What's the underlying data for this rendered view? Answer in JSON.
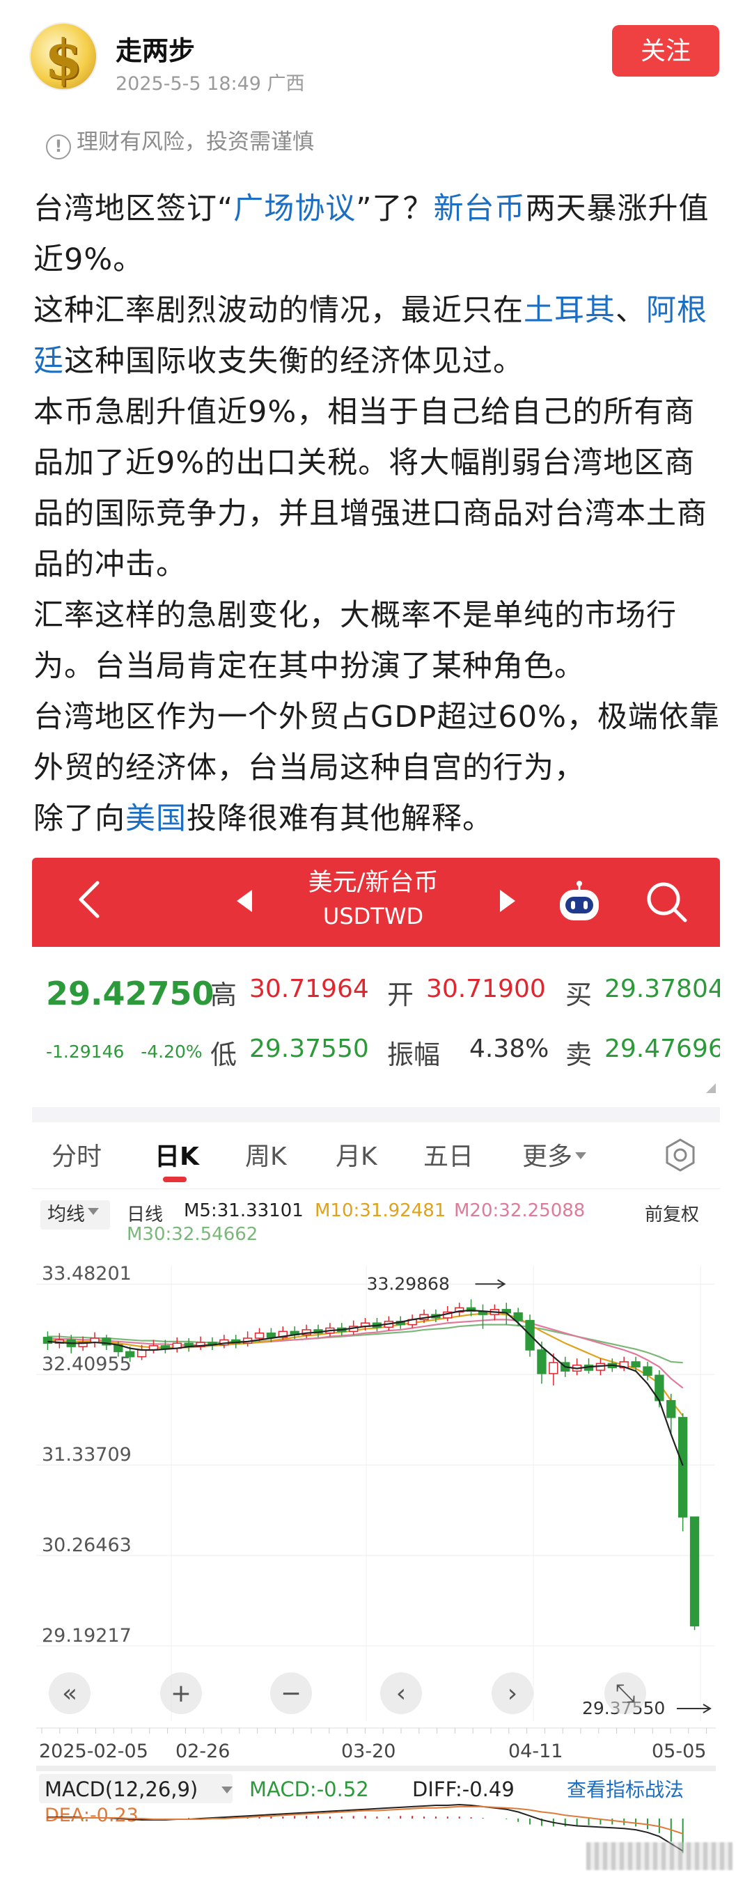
{
  "post": {
    "author": "走两步",
    "meta": "2025-5-5 18:49 广西",
    "follow_label": "关注",
    "risk_notice": "理财有风险，投资需谨慎"
  },
  "article": {
    "p1_a": "台湾地区签订“",
    "p1_link1": "广场协议",
    "p1_b": "”了？",
    "p1_link2": "新台币",
    "p1_c": "两天暴涨升值近9%。",
    "p2_a": "这种汇率剧烈波动的情况，最近只在",
    "p2_link1": "土耳其",
    "p2_b": "、",
    "p2_link2": "阿根廷",
    "p2_c": "这种国际收支失衡的经济体见过。",
    "p3": "本币急剧升值近9%，相当于自己给自己的所有商品加了近9%的出口关税。将大幅削弱台湾地区商品的国际竞争力，并且增强进口商品对台湾本土商品的冲击。",
    "p4": "汇率这样的急剧变化，大概率不是单纯的市场行为。台当局肯定在其中扮演了某种角色。",
    "p5": "台湾地区作为一个外贸占GDP超过60%，极端依靠外贸的经济体，台当局这种自宫的行为，",
    "p6_a": "除了向",
    "p6_link": "美国",
    "p6_b": "投降很难有其他解释。"
  },
  "quote": {
    "pair_name": "美元/新台币",
    "pair_code": "USDTWD",
    "price": "29.42750",
    "change": "-1.29146",
    "change_pct": "-4.20%",
    "stats": {
      "high_label": "高",
      "high": "30.71964",
      "open_label": "开",
      "open": "30.71900",
      "buy_label": "买",
      "buy": "29.37804",
      "low_label": "低",
      "low": "29.37550",
      "amp_label": "振幅",
      "amp": "4.38%",
      "sell_label": "卖",
      "sell": "29.47696"
    },
    "tabs": [
      "分时",
      "日K",
      "周K",
      "月K",
      "五日",
      "更多"
    ],
    "active_tab": "日K",
    "avg_dropdown": "均线",
    "ma": {
      "day": "日线",
      "m5": "M5:31.33101",
      "m10": "M10:31.92481",
      "m20": "M20:32.25088",
      "m30": "M30:32.54662",
      "adjust": "前复权"
    },
    "colors": {
      "up": "#e0262e",
      "down": "#2c9a3a",
      "m5": "#222222",
      "m10": "#e0a21b",
      "m20": "#e07a9a",
      "m30": "#7ab87a"
    },
    "macd": {
      "label": "MACD(12,26,9)",
      "macd": "MACD:-0.52",
      "diff": "DIFF:-0.49",
      "dea": "DEA:-0.23",
      "link": "查看指标战法"
    }
  },
  "chart_data": {
    "type": "candlestick",
    "y_ticks": [
      "33.48201",
      "32.40955",
      "31.33709",
      "30.26463",
      "29.19217"
    ],
    "y_tick_values": [
      33.48201,
      32.40955,
      31.33709,
      30.26463,
      29.19217
    ],
    "ylim": [
      29.19217,
      33.48201
    ],
    "x_ticks": [
      "2025-02-05",
      "02-26",
      "03-20",
      "04-11",
      "05-05"
    ],
    "max_label": "33.29868",
    "min_label": "29.37550",
    "candles": [
      {
        "o": 32.85,
        "c": 32.78,
        "h": 32.92,
        "l": 32.7
      },
      {
        "o": 32.78,
        "c": 32.82,
        "h": 32.9,
        "l": 32.72
      },
      {
        "o": 32.82,
        "c": 32.74,
        "h": 32.88,
        "l": 32.66
      },
      {
        "o": 32.74,
        "c": 32.79,
        "h": 32.86,
        "l": 32.69
      },
      {
        "o": 32.79,
        "c": 32.84,
        "h": 32.91,
        "l": 32.73
      },
      {
        "o": 32.84,
        "c": 32.76,
        "h": 32.88,
        "l": 32.7
      },
      {
        "o": 32.76,
        "c": 32.68,
        "h": 32.8,
        "l": 32.62
      },
      {
        "o": 32.68,
        "c": 32.62,
        "h": 32.74,
        "l": 32.56
      },
      {
        "o": 32.62,
        "c": 32.7,
        "h": 32.76,
        "l": 32.58
      },
      {
        "o": 32.7,
        "c": 32.75,
        "h": 32.82,
        "l": 32.66
      },
      {
        "o": 32.75,
        "c": 32.72,
        "h": 32.82,
        "l": 32.66
      },
      {
        "o": 32.72,
        "c": 32.78,
        "h": 32.85,
        "l": 32.67
      },
      {
        "o": 32.78,
        "c": 32.74,
        "h": 32.84,
        "l": 32.68
      },
      {
        "o": 32.74,
        "c": 32.79,
        "h": 32.86,
        "l": 32.7
      },
      {
        "o": 32.79,
        "c": 32.76,
        "h": 32.85,
        "l": 32.7
      },
      {
        "o": 32.76,
        "c": 32.82,
        "h": 32.88,
        "l": 32.72
      },
      {
        "o": 32.82,
        "c": 32.78,
        "h": 32.88,
        "l": 32.72
      },
      {
        "o": 32.78,
        "c": 32.84,
        "h": 32.92,
        "l": 32.74
      },
      {
        "o": 32.84,
        "c": 32.9,
        "h": 32.96,
        "l": 32.8
      },
      {
        "o": 32.9,
        "c": 32.85,
        "h": 32.96,
        "l": 32.79
      },
      {
        "o": 32.85,
        "c": 32.92,
        "h": 32.98,
        "l": 32.82
      },
      {
        "o": 32.92,
        "c": 32.88,
        "h": 32.98,
        "l": 32.83
      },
      {
        "o": 32.88,
        "c": 32.94,
        "h": 33.0,
        "l": 32.84
      },
      {
        "o": 32.94,
        "c": 32.9,
        "h": 33.0,
        "l": 32.85
      },
      {
        "o": 32.9,
        "c": 32.96,
        "h": 33.02,
        "l": 32.86
      },
      {
        "o": 32.96,
        "c": 32.92,
        "h": 33.02,
        "l": 32.87
      },
      {
        "o": 32.92,
        "c": 32.98,
        "h": 33.05,
        "l": 32.88
      },
      {
        "o": 32.98,
        "c": 33.02,
        "h": 33.08,
        "l": 32.93
      },
      {
        "o": 33.02,
        "c": 32.97,
        "h": 33.08,
        "l": 32.92
      },
      {
        "o": 32.97,
        "c": 33.04,
        "h": 33.1,
        "l": 32.93
      },
      {
        "o": 33.04,
        "c": 33.0,
        "h": 33.1,
        "l": 32.95
      },
      {
        "o": 33.0,
        "c": 33.06,
        "h": 33.12,
        "l": 32.96
      },
      {
        "o": 33.06,
        "c": 33.12,
        "h": 33.18,
        "l": 33.02
      },
      {
        "o": 33.12,
        "c": 33.08,
        "h": 33.18,
        "l": 33.03
      },
      {
        "o": 33.08,
        "c": 33.15,
        "h": 33.22,
        "l": 33.04
      },
      {
        "o": 33.15,
        "c": 33.2,
        "h": 33.26,
        "l": 33.1
      },
      {
        "o": 33.2,
        "c": 33.16,
        "h": 33.3,
        "l": 33.1
      },
      {
        "o": 33.16,
        "c": 33.12,
        "h": 33.24,
        "l": 32.95
      },
      {
        "o": 33.12,
        "c": 33.18,
        "h": 33.24,
        "l": 33.05
      },
      {
        "o": 33.18,
        "c": 33.14,
        "h": 33.26,
        "l": 33.0
      },
      {
        "o": 33.14,
        "c": 33.05,
        "h": 33.2,
        "l": 32.98
      },
      {
        "o": 33.05,
        "c": 32.7,
        "h": 33.12,
        "l": 32.62
      },
      {
        "o": 32.7,
        "c": 32.42,
        "h": 32.8,
        "l": 32.3
      },
      {
        "o": 32.42,
        "c": 32.55,
        "h": 32.66,
        "l": 32.28
      },
      {
        "o": 32.55,
        "c": 32.45,
        "h": 32.62,
        "l": 32.38
      },
      {
        "o": 32.45,
        "c": 32.52,
        "h": 32.6,
        "l": 32.4
      },
      {
        "o": 32.52,
        "c": 32.46,
        "h": 32.6,
        "l": 32.42
      },
      {
        "o": 32.46,
        "c": 32.54,
        "h": 32.6,
        "l": 32.4
      },
      {
        "o": 32.54,
        "c": 32.49,
        "h": 32.6,
        "l": 32.44
      },
      {
        "o": 32.49,
        "c": 32.56,
        "h": 32.62,
        "l": 32.45
      },
      {
        "o": 32.56,
        "c": 32.5,
        "h": 32.62,
        "l": 32.44
      },
      {
        "o": 32.5,
        "c": 32.4,
        "h": 32.56,
        "l": 32.34
      },
      {
        "o": 32.4,
        "c": 32.1,
        "h": 32.46,
        "l": 32.02
      },
      {
        "o": 32.1,
        "c": 31.9,
        "h": 32.18,
        "l": 31.7
      },
      {
        "o": 31.9,
        "c": 30.72,
        "h": 31.95,
        "l": 30.55
      },
      {
        "o": 30.72,
        "c": 29.43,
        "h": 30.72,
        "l": 29.38
      }
    ],
    "ma5": [
      32.8,
      32.79,
      32.78,
      32.78,
      32.79,
      32.78,
      32.76,
      32.72,
      32.7,
      32.7,
      32.71,
      32.72,
      32.74,
      32.75,
      32.76,
      32.78,
      32.79,
      32.8,
      32.82,
      32.84,
      32.86,
      32.88,
      32.9,
      32.91,
      32.93,
      32.94,
      32.96,
      32.98,
      32.99,
      33.01,
      33.03,
      33.06,
      33.08,
      33.1,
      33.13,
      33.16,
      33.17,
      33.16,
      33.15,
      33.14,
      33.02,
      32.88,
      32.74,
      32.62,
      32.5,
      32.48,
      32.5,
      32.51,
      32.52,
      32.5,
      32.45,
      32.3,
      32.1,
      31.7,
      31.33
    ],
    "ma10": [
      32.82,
      32.81,
      32.8,
      32.8,
      32.8,
      32.79,
      32.78,
      32.76,
      32.74,
      32.73,
      32.73,
      32.73,
      32.73,
      32.74,
      32.75,
      32.76,
      32.77,
      32.78,
      32.79,
      32.81,
      32.83,
      32.85,
      32.87,
      32.88,
      32.9,
      32.91,
      32.93,
      32.95,
      32.96,
      32.98,
      33.0,
      33.02,
      33.04,
      33.06,
      33.08,
      33.1,
      33.12,
      33.13,
      33.13,
      33.12,
      33.08,
      33.0,
      32.92,
      32.85,
      32.78,
      32.72,
      32.66,
      32.6,
      32.56,
      32.52,
      32.48,
      32.4,
      32.3,
      32.1,
      31.92
    ],
    "ma20": [
      32.84,
      32.83,
      32.83,
      32.82,
      32.82,
      32.81,
      32.8,
      32.79,
      32.78,
      32.77,
      32.77,
      32.76,
      32.76,
      32.76,
      32.76,
      32.77,
      32.77,
      32.78,
      32.79,
      32.8,
      32.81,
      32.82,
      32.83,
      32.84,
      32.86,
      32.87,
      32.88,
      32.9,
      32.91,
      32.93,
      32.94,
      32.96,
      32.98,
      33.0,
      33.02,
      33.03,
      33.04,
      33.05,
      33.06,
      33.06,
      33.05,
      33.02,
      32.98,
      32.94,
      32.9,
      32.86,
      32.82,
      32.78,
      32.74,
      32.7,
      32.65,
      32.58,
      32.5,
      32.36,
      32.25
    ],
    "ma30": [
      32.86,
      32.86,
      32.85,
      32.85,
      32.84,
      32.84,
      32.83,
      32.82,
      32.81,
      32.81,
      32.8,
      32.8,
      32.8,
      32.79,
      32.79,
      32.79,
      32.8,
      32.8,
      32.8,
      32.81,
      32.82,
      32.82,
      32.83,
      32.84,
      32.85,
      32.86,
      32.87,
      32.88,
      32.89,
      32.9,
      32.91,
      32.92,
      32.94,
      32.95,
      32.96,
      32.98,
      32.99,
      33.0,
      33.0,
      33.0,
      32.99,
      32.97,
      32.95,
      32.92,
      32.89,
      32.86,
      32.83,
      32.8,
      32.77,
      32.74,
      32.71,
      32.67,
      32.62,
      32.56,
      32.55
    ],
    "macd_hist": [
      0.02,
      0.01,
      0.0,
      -0.01,
      0.0,
      0.01,
      0.0,
      -0.02,
      -0.03,
      -0.02,
      -0.01,
      0.0,
      0.01,
      0.01,
      0.02,
      0.02,
      0.02,
      0.03,
      0.03,
      0.03,
      0.03,
      0.04,
      0.04,
      0.04,
      0.03,
      0.03,
      0.04,
      0.04,
      0.03,
      0.03,
      0.04,
      0.04,
      0.03,
      0.03,
      0.03,
      0.03,
      0.02,
      0.01,
      0.0,
      -0.01,
      -0.05,
      -0.09,
      -0.11,
      -0.12,
      -0.12,
      -0.11,
      -0.1,
      -0.09,
      -0.09,
      -0.1,
      -0.12,
      -0.16,
      -0.22,
      -0.35,
      -0.52
    ],
    "diff": [
      0.02,
      0.02,
      0.02,
      0.01,
      0.01,
      0.01,
      0.0,
      -0.01,
      -0.02,
      -0.02,
      -0.02,
      -0.01,
      -0.01,
      0.0,
      0.01,
      0.02,
      0.03,
      0.04,
      0.05,
      0.06,
      0.07,
      0.08,
      0.09,
      0.1,
      0.11,
      0.12,
      0.13,
      0.14,
      0.15,
      0.16,
      0.17,
      0.18,
      0.19,
      0.2,
      0.2,
      0.21,
      0.2,
      0.18,
      0.16,
      0.14,
      0.1,
      0.04,
      -0.02,
      -0.06,
      -0.09,
      -0.11,
      -0.12,
      -0.13,
      -0.14,
      -0.15,
      -0.17,
      -0.21,
      -0.27,
      -0.38,
      -0.49
    ],
    "dea": [
      0.01,
      0.01,
      0.01,
      0.01,
      0.01,
      0.01,
      0.01,
      0.0,
      0.0,
      -0.01,
      -0.01,
      -0.01,
      -0.01,
      -0.01,
      0.0,
      0.0,
      0.01,
      0.02,
      0.03,
      0.04,
      0.05,
      0.06,
      0.07,
      0.08,
      0.09,
      0.1,
      0.11,
      0.12,
      0.12,
      0.13,
      0.14,
      0.15,
      0.16,
      0.16,
      0.17,
      0.18,
      0.18,
      0.18,
      0.17,
      0.16,
      0.15,
      0.13,
      0.1,
      0.08,
      0.05,
      0.03,
      0.01,
      -0.01,
      -0.03,
      -0.05,
      -0.07,
      -0.09,
      -0.12,
      -0.17,
      -0.23
    ]
  }
}
